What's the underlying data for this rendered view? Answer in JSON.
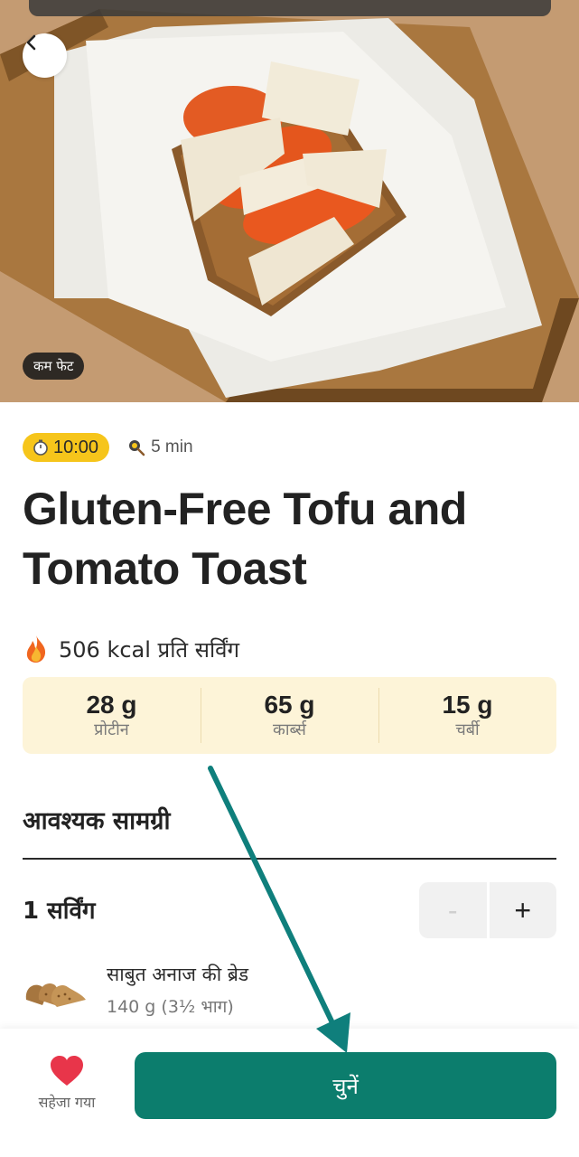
{
  "hero": {
    "tag_label": "कम फेट",
    "image_alt": "tofu-tomato-toast-photo"
  },
  "meta": {
    "time": "10:00",
    "prep_time": "5 min"
  },
  "recipe": {
    "title": "Gluten-Free Tofu and Tomato Toast"
  },
  "nutrition": {
    "kcal_text": "506 kcal प्रति सर्विंग",
    "macros": [
      {
        "value": "28 g",
        "label": "प्रोटीन"
      },
      {
        "value": "65 g",
        "label": "कार्ब्स"
      },
      {
        "value": "15 g",
        "label": "चर्बी"
      }
    ]
  },
  "ingredients_section": {
    "heading": "आवश्यक सामग्री",
    "servings": "1 सर्विंग",
    "minus": "-",
    "plus": "+",
    "items": [
      {
        "name": "साबुत अनाज की ब्रेड",
        "qty": "140 g (3½ भाग)"
      }
    ]
  },
  "bottom": {
    "save_label": "सहेजा गया",
    "choose_label": "चुनें"
  },
  "colors": {
    "accent": "#0c7d6d",
    "time_badge": "#f6c51b",
    "macro_bg": "#fdf4d8",
    "heart": "#e8354a",
    "annotation_arrow": "#0f7f7c"
  },
  "icons": {
    "back": "chevron-left-icon",
    "timer": "stopwatch-icon",
    "prep": "frying-pan-icon",
    "kcal": "fire-icon",
    "save": "heart-icon"
  }
}
